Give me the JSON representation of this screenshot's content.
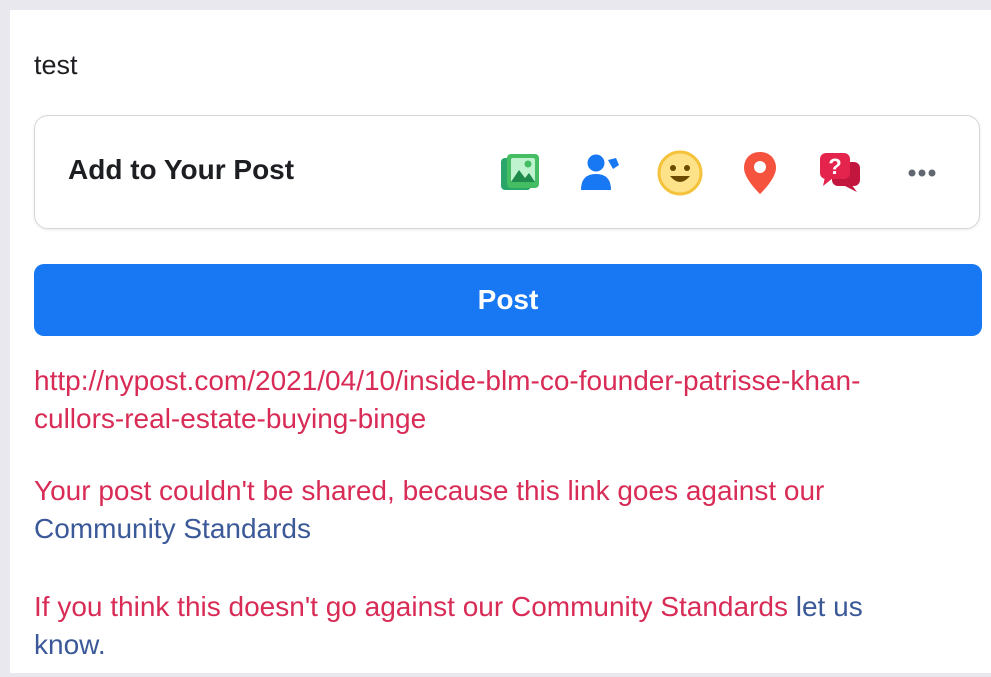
{
  "composer": {
    "text": "test"
  },
  "add_to_post": {
    "label": "Add to Your Post",
    "icons": [
      "photo-icon",
      "tag-people-icon",
      "feeling-icon",
      "location-icon",
      "question-icon",
      "more-icon"
    ]
  },
  "post_button": {
    "label": "Post",
    "color": "#1877f2"
  },
  "error": {
    "url_line1": "http://nypost.com/2021/04/10/inside-blm-co-founder-patrisse-khan-",
    "url_line2": "cullors-real-estate-buying-binge",
    "message": "Your post couldn't be shared, because this link goes against our",
    "standards_link": "Community Standards",
    "appeal_text": "If you think this doesn't go against our Community Standards",
    "appeal_link_1": "let us",
    "appeal_link_2": "know.",
    "error_color": "#d82b56",
    "link_color": "#3b5998"
  }
}
